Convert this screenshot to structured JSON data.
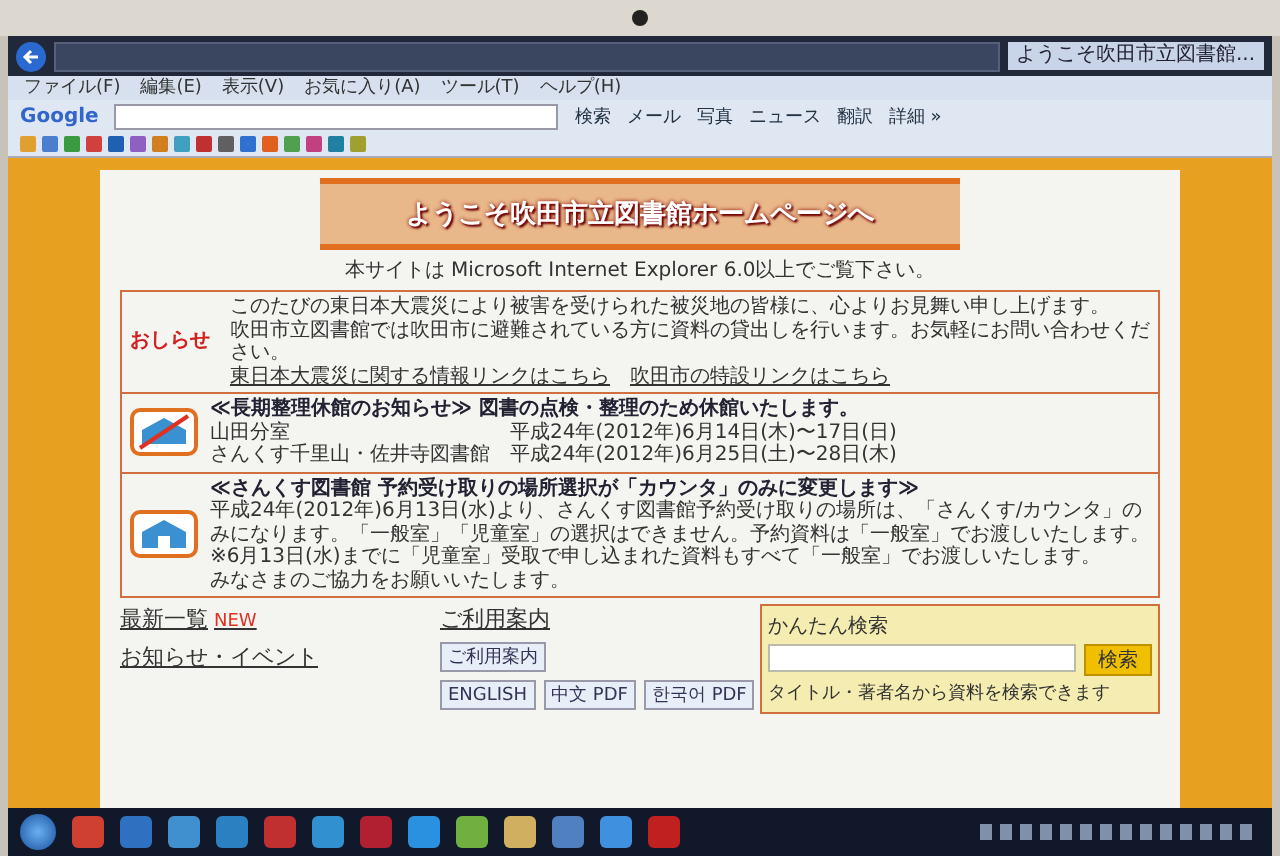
{
  "browser": {
    "tab_title": "ようこそ吹田市立図書館...",
    "menu": [
      "ファイル(F)",
      "編集(E)",
      "表示(V)",
      "お気に入り(A)",
      "ツール(T)",
      "ヘルプ(H)"
    ],
    "google": {
      "logo": "Google",
      "buttons": [
        "検索",
        "メール",
        "写真",
        "ニュース",
        "翻訳",
        "詳細 »"
      ]
    }
  },
  "page": {
    "banner_title": "ようこそ吹田市立図書館ホームページへ",
    "browser_notice": "本サイトは Microsoft Internet Explorer 6.0以上でご覧下さい。",
    "notices": [
      {
        "kind": "text",
        "label": "おしらせ",
        "lines": [
          "このたびの東日本大震災により被害を受けられた被災地の皆様に、心よりお見舞い申し上げます。",
          "吹田市立図書館では吹田市に避難されている方に資料の貸出しを行います。お気軽にお問い合わせください。"
        ],
        "links": [
          "東日本大震災に関する情報リンクはこちら",
          "吹田市の特設リンクはこちら"
        ]
      },
      {
        "kind": "closure",
        "title": "≪長期整理休館のお知らせ≫ 図書の点検・整理のため休館いたします。",
        "schedule": [
          {
            "place": "山田分室",
            "date": "平成24年(2012年)6月14日(木)〜17日(日)"
          },
          {
            "place": "さんくす千里山・佐井寺図書館",
            "date": "平成24年(2012年)6月25日(土)〜28日(木)"
          }
        ]
      },
      {
        "kind": "change",
        "title": "≪さんくす図書館 予約受け取りの場所選択が「カウンタ」のみに変更します≫",
        "lines": [
          "平成24年(2012年)6月13日(水)より、さんくす図書館予約受け取りの場所は、「さんくす/カウンタ」のみになります。「一般室」「児童室」の選択はできません。予約資料は「一般室」でお渡しいたします。",
          "※6月13日(水)までに「児童室」受取で申し込まれた資料もすべて「一般室」でお渡しいたします。",
          "みなさまのご協力をお願いいたします。"
        ]
      }
    ],
    "latest": {
      "title": "最新一覧",
      "badge": "NEW"
    },
    "events": "お知らせ・イベント",
    "guide": {
      "title": "ご利用案内",
      "button": "ご利用案内",
      "languages": [
        "ENGLISH",
        "中文 PDF",
        "한국어 PDF"
      ]
    },
    "search": {
      "title": "かんたん検索",
      "button": "検索",
      "hint": "タイトル・著者名から資料を検索できます"
    }
  }
}
